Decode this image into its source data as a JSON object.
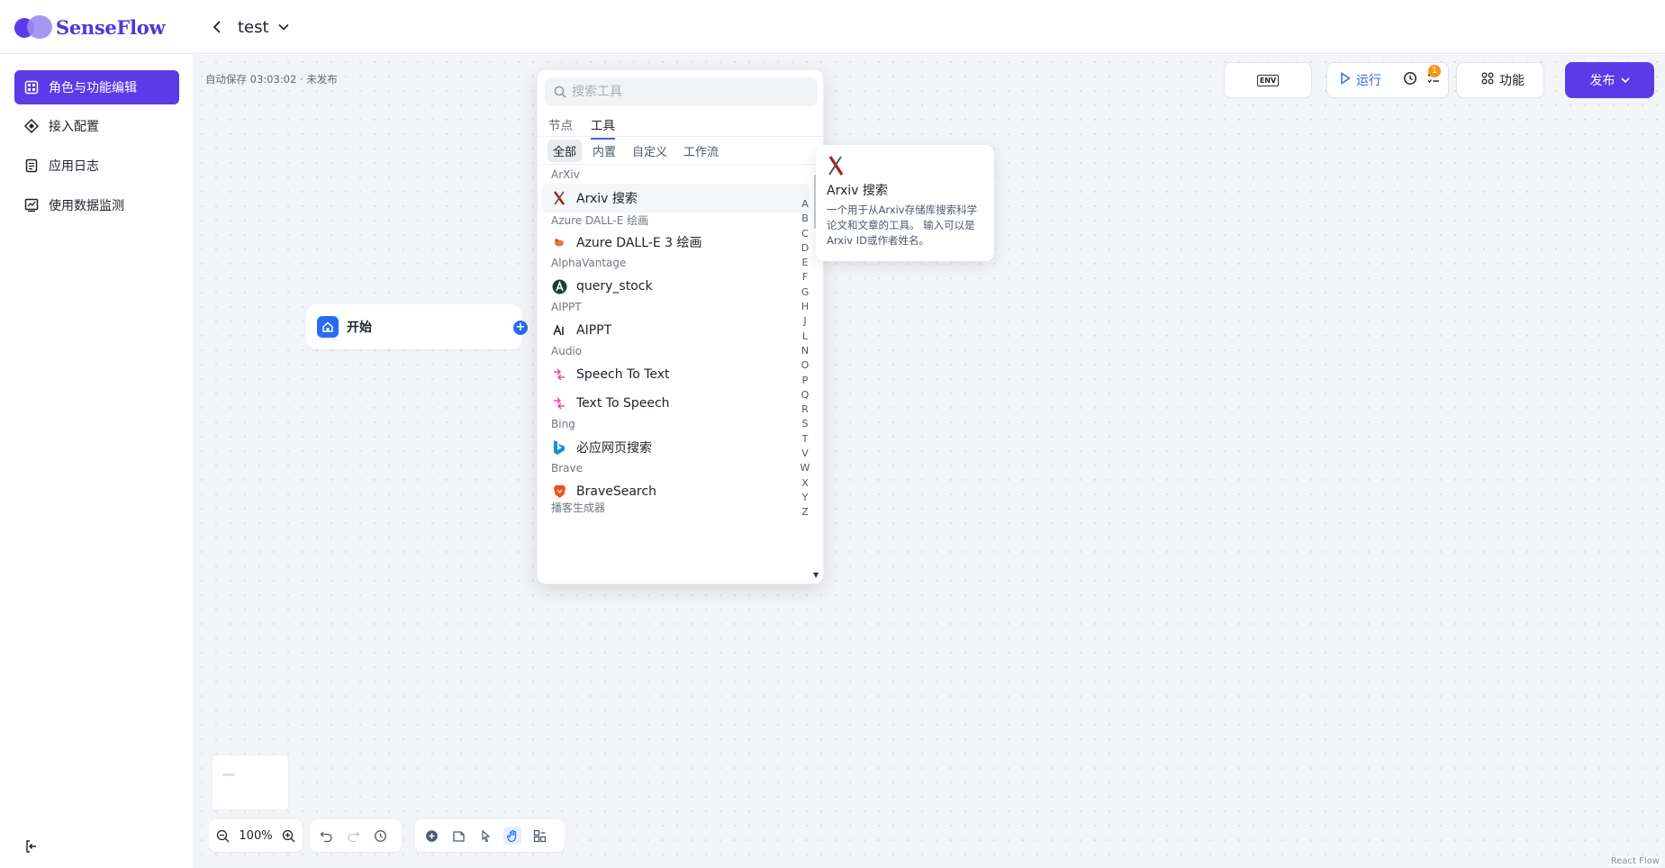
{
  "brand": {
    "name": "SenseFlow"
  },
  "header": {
    "app_name": "test"
  },
  "sidebar": {
    "items": [
      {
        "label": "角色与功能编辑",
        "active": true
      },
      {
        "label": "接入配置"
      },
      {
        "label": "应用日志"
      },
      {
        "label": "使用数据监测"
      }
    ]
  },
  "canvas": {
    "autosave": "自动保存 03:03:02 · 未发布",
    "start_node": "开始",
    "attribution": "React Flow",
    "zoom": "100%"
  },
  "toolbar": {
    "env": "ENV",
    "run": "运行",
    "notif_count": "1",
    "features": "功能",
    "publish": "发布"
  },
  "picker": {
    "search_placeholder": "搜索工具",
    "tabs": [
      "节点",
      "工具"
    ],
    "active_tab": "工具",
    "filters": [
      "全部",
      "内置",
      "自定义",
      "工作流"
    ],
    "groups": [
      {
        "label": "ArXiv",
        "tools": [
          "Arxiv 搜索"
        ]
      },
      {
        "label": "Azure DALL-E 绘画",
        "tools": [
          "Azure DALL-E 3 绘画"
        ]
      },
      {
        "label": "AlphaVantage",
        "tools": [
          "query_stock"
        ]
      },
      {
        "label": "AIPPT",
        "tools": [
          "AIPPT"
        ]
      },
      {
        "label": "Audio",
        "tools": [
          "Speech To Text",
          "Text To Speech"
        ]
      },
      {
        "label": "Bing",
        "tools": [
          "必应网页搜索"
        ]
      },
      {
        "label": "Brave",
        "tools": [
          "BraveSearch"
        ]
      },
      {
        "label": "播客生成器",
        "tools": []
      }
    ],
    "alphabet": [
      "A",
      "B",
      "C",
      "D",
      "E",
      "F",
      "G",
      "H",
      "J",
      "L",
      "N",
      "O",
      "P",
      "Q",
      "R",
      "S",
      "T",
      "V",
      "W",
      "X",
      "Y",
      "Z"
    ]
  },
  "tooltip": {
    "title": "Arxiv 搜索",
    "description": "一个用于从Arxiv存储库搜索科学论文和文章的工具。 输入可以是Arxiv ID或作者姓名。"
  },
  "colors": {
    "primary": "#5b3be8",
    "run_blue": "#3b63f0",
    "start_blue": "#2a6bf2",
    "notif_orange": "#f7931a"
  }
}
